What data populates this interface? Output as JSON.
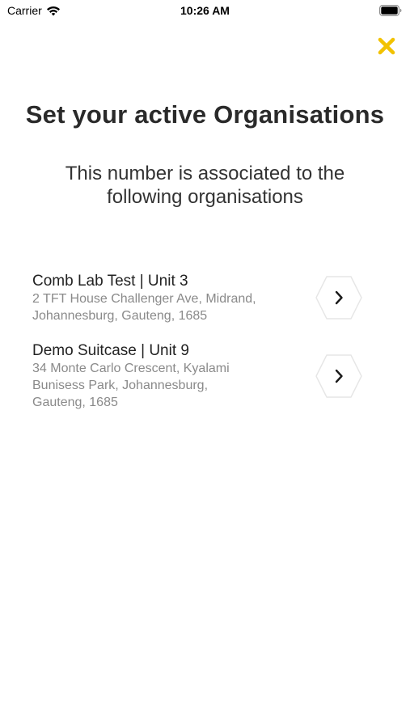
{
  "status_bar": {
    "carrier": "Carrier",
    "time": "10:26 AM"
  },
  "header": {
    "close_icon": "close-icon",
    "close_color": "#F2C200"
  },
  "title": "Set your active Organisations",
  "subtitle": {
    "line1": "This number is associated to the",
    "line2": "following organisations"
  },
  "organisations": [
    {
      "name": "Comb Lab Test | Unit 3",
      "address_lines": [
        "2 TFT House Challenger Ave, Midrand,",
        "Johannesburg, Gauteng, 1685"
      ],
      "action_icon": "chevron-right-icon"
    },
    {
      "name": "Demo Suitcase | Unit 9",
      "address_lines": [
        "34 Monte Carlo Crescent, Kyalami",
        "Bunisess Park, Johannesburg,",
        "Gauteng, 1685"
      ],
      "action_icon": "chevron-right-icon"
    }
  ],
  "colors": {
    "accent": "#F2C200",
    "text_primary": "#222222",
    "text_secondary": "#8a8a8a"
  }
}
